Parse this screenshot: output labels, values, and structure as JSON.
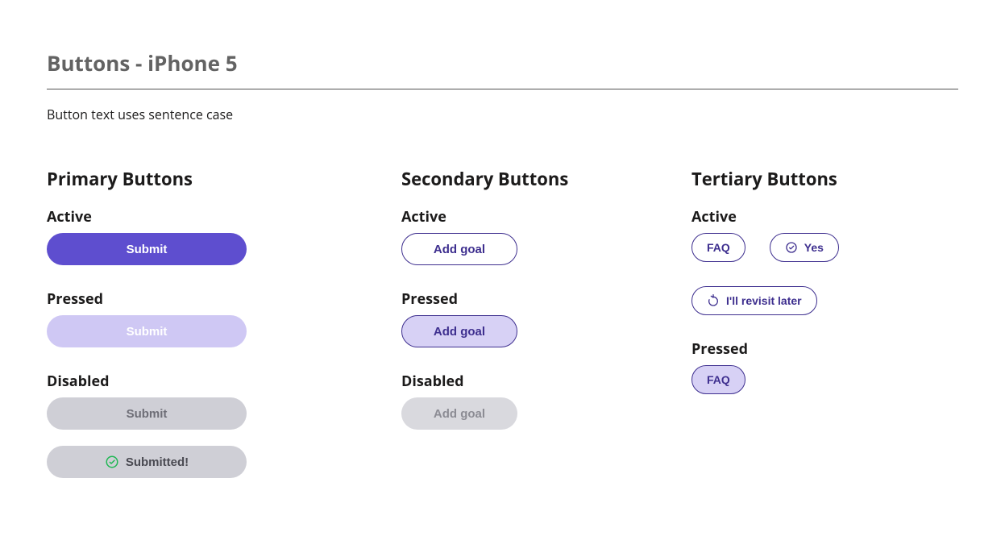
{
  "page": {
    "title": "Buttons - iPhone 5",
    "subtitle": "Button text uses sentence case"
  },
  "primary": {
    "heading": "Primary Buttons",
    "active": {
      "label": "Active",
      "button": "Submit"
    },
    "pressed": {
      "label": "Pressed",
      "button": "Submit"
    },
    "disabled": {
      "label": "Disabled",
      "button": "Submit",
      "submitted": "Submitted!"
    }
  },
  "secondary": {
    "heading": "Secondary Buttons",
    "active": {
      "label": "Active",
      "button": "Add goal"
    },
    "pressed": {
      "label": "Pressed",
      "button": "Add goal"
    },
    "disabled": {
      "label": "Disabled",
      "button": "Add goal"
    }
  },
  "tertiary": {
    "heading": "Tertiary Buttons",
    "active": {
      "label": "Active",
      "faq": "FAQ",
      "yes": "Yes",
      "revisit": "I'll revisit later"
    },
    "pressed": {
      "label": "Pressed",
      "faq": "FAQ"
    }
  }
}
